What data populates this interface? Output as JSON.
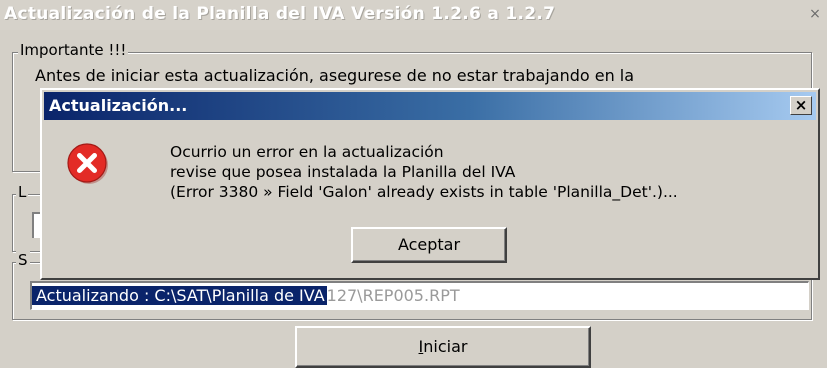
{
  "window": {
    "title": "Actualización de la Planilla del IVA Versión 1.2.6 a 1.2.7",
    "close_glyph": "×"
  },
  "important_group": {
    "legend": "Importante !!!",
    "text": "Antes de iniciar esta actualización, asegurese de no estar trabajando en la"
  },
  "group_l": {
    "legend": "L"
  },
  "group_s": {
    "legend": "S"
  },
  "status": {
    "highlighted": "Actualizando : C:\\SAT\\Planilla de IVA",
    "rest": "127\\REP005.RPT"
  },
  "start_button": {
    "mnemonic": "I",
    "label_rest": "niciar"
  },
  "dialog": {
    "title": "Actualización...",
    "close_glyph": "×",
    "icon": "error-icon",
    "lines": [
      "Ocurrio un error en la actualización",
      "revise que posea instalada la Planilla del IVA",
      "(Error 3380 » Field 'Galon' already exists in table 'Planilla_Det'.)..."
    ],
    "ok_label": "Aceptar"
  },
  "colors": {
    "face": "#d4d0c8",
    "selection": "#0a246a",
    "error_red": "#e32b26"
  }
}
